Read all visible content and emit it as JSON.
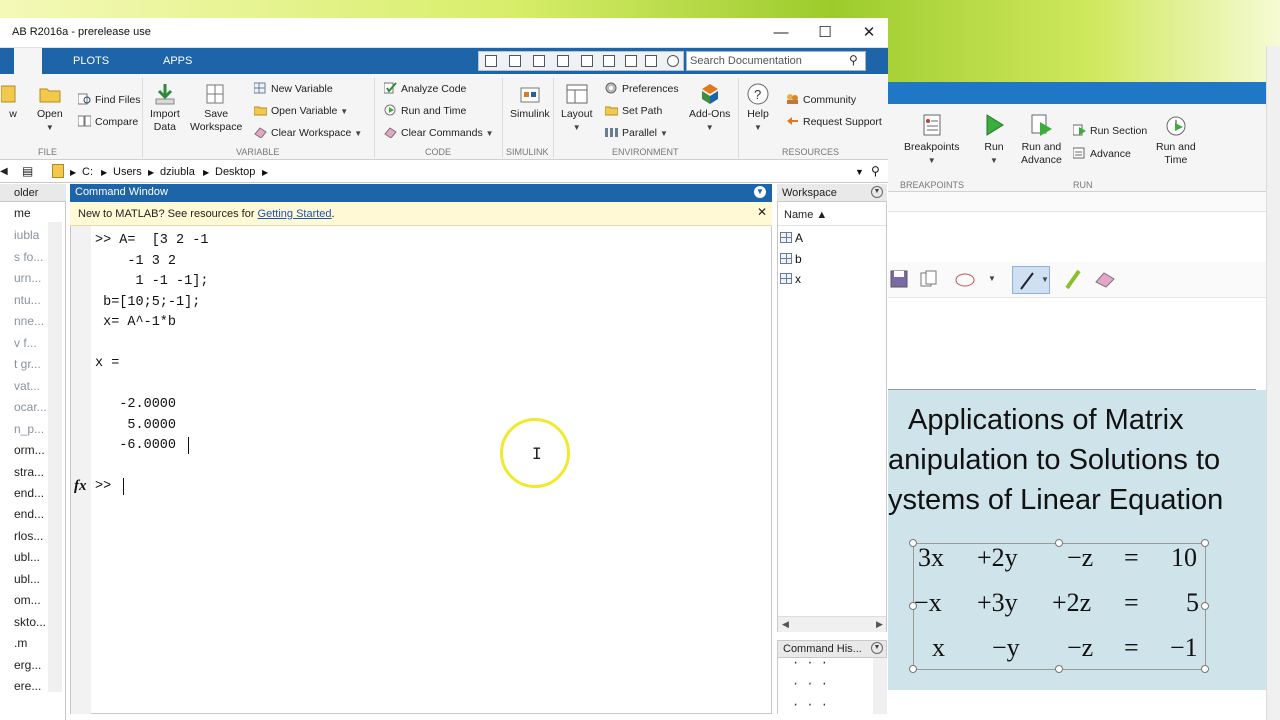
{
  "window": {
    "title": "AB R2016a - prerelease use",
    "minimize_glyph": "—",
    "maximize_glyph": "☐",
    "close_glyph": "✕"
  },
  "tabs": [
    {
      "label": "PLOTS"
    },
    {
      "label": "APPS"
    }
  ],
  "search": {
    "placeholder": "Search Documentation"
  },
  "ribbon": {
    "file": {
      "label": "FILE",
      "buttons": [
        "w",
        "Open"
      ],
      "find_files": "Find Files",
      "compare": "Compare"
    },
    "variable": {
      "label": "VARIABLE",
      "import_data": [
        "Import",
        "Data"
      ],
      "save_workspace": [
        "Save",
        "Workspace"
      ],
      "new_variable": "New Variable",
      "open_variable": "Open Variable",
      "clear_workspace": "Clear Workspace"
    },
    "code": {
      "label": "CODE",
      "analyze_code": "Analyze Code",
      "run_and_time": "Run and Time",
      "clear_commands": "Clear Commands"
    },
    "simulink": {
      "label": "SIMULINK",
      "button": "Simulink"
    },
    "environment": {
      "label": "ENVIRONMENT",
      "layout": "Layout",
      "preferences": "Preferences",
      "set_path": "Set Path",
      "parallel": "Parallel",
      "add_ons": [
        "Add-Ons"
      ]
    },
    "resources": {
      "label": "RESOURCES",
      "help": "Help",
      "community": "Community",
      "request_support": "Request Support"
    }
  },
  "address": {
    "parts": [
      "C:",
      "Users",
      "dziubla",
      "Desktop"
    ]
  },
  "file_panel": {
    "header": "older",
    "items": [
      "me",
      "iubla",
      "s fo...",
      "urn...",
      "ntu...",
      "nne...",
      "v f...",
      "t gr...",
      "vat...",
      "ocar...",
      "n_p...",
      "orm...",
      "stra...",
      "end...",
      "end...",
      "rlos...",
      "ubl...",
      "ubl...",
      "om...",
      "skto...",
      ".m",
      "erg...",
      "ere..."
    ]
  },
  "command_window": {
    "title": "Command Window",
    "info_text": "New to MATLAB? See resources for ",
    "info_link": "Getting Started",
    "info_end": ".",
    "lines": [
      ">> A=  [3 2 -1",
      "    -1 3 2",
      "     1 -1 -1];",
      " b=[10;5;-1];",
      " x= A^-1*b",
      "",
      "x =",
      "",
      "   -2.0000",
      "    5.0000",
      "   -6.0000"
    ],
    "prompt": ">>",
    "fx": "fx"
  },
  "workspace": {
    "title": "Workspace",
    "column": "Name ▲",
    "variables": [
      "A",
      "b",
      "x"
    ]
  },
  "command_history": {
    "title": "Command His...",
    "items": [
      "· · ·",
      "· · ·",
      "· · ·"
    ]
  },
  "bg_app": {
    "buttons": {
      "breakpoints": "Breakpoints",
      "run": "Run",
      "run_and_advance": [
        "Run and",
        "Advance"
      ],
      "run_section": "Run Section",
      "advance": "Advance",
      "run_and_time": [
        "Run and",
        "Time"
      ]
    },
    "sections": {
      "breakpoints": "BREAKPOINTS",
      "run": "RUN"
    },
    "slide": {
      "title_lines": [
        "Applications of Matrix",
        "anipulation to Solutions to",
        "ystems of Linear Equation"
      ],
      "equations": [
        [
          "3x",
          "+2y",
          "−z",
          "=",
          "10"
        ],
        [
          "−x",
          "+3y",
          "+2z",
          "=",
          "5"
        ],
        [
          "x",
          "−y",
          "−z",
          "=",
          "−1"
        ]
      ]
    }
  },
  "colors": {
    "matlab_blue": "#1d64a8",
    "slide_bg": "#cfe4ea",
    "cursor_ring": "#f1ea2c"
  }
}
